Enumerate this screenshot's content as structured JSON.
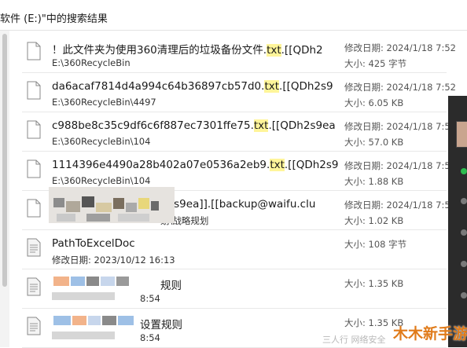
{
  "window": {
    "title": "软件 (E:)\"中的搜索结果"
  },
  "results": [
    {
      "name_pre": "！此文件夹为使用360清理后的垃圾备份文件.",
      "name_hl": "txt",
      "name_post": ".[[QDh2",
      "path": "E:\\360RecycleBin",
      "date": "修改日期: 2024/1/18 7:52",
      "size": "大小: 425 字节"
    },
    {
      "name_pre": "da6acaf7814d4a994c64b36897cb57d0.",
      "name_hl": "txt",
      "name_post": ".[[QDh2s9",
      "path": "E:\\360RecycleBin\\4497",
      "date": "修改日期: 2024/1/18 7:52",
      "size": "大小: 6.05 KB"
    },
    {
      "name_pre": "c988be8c35c9df6c6f887ec7301ffe75.",
      "name_hl": "txt",
      "name_post": ".[[QDh2s9ea",
      "path": "E:\\360RecycleBin\\104",
      "date": "修改日期: 2024/1/18 7:5",
      "size": "大小: 57.0 KB"
    },
    {
      "name_pre": "1114396e4490a28b402a07e0536a2eb9.",
      "name_hl": "txt",
      "name_post": ".[[QDh2s9",
      "path": "E:\\360RecycleBin\\104",
      "date": "修改日期: 2024/1/18 7:5",
      "size": "大小: 1.88 KB"
    },
    {
      "name_pre": "h2s9ea]].[[backup@waifu.clu",
      "name_hl": "",
      "name_post": "",
      "path": "划\\战略规划",
      "date": "修改日期: 2024/1/18 7:5",
      "size": "大小: 1.02 KB"
    },
    {
      "name_pre": "PathToExcelDoc",
      "name_hl": "",
      "name_post": "",
      "path": "修改日期: 2023/10/12 16:13",
      "date": "",
      "size": "大小: 108 字节"
    },
    {
      "name_pre": "规则",
      "name_hl": "",
      "name_post": "",
      "path": "8:54",
      "date": "",
      "size": "大小: 1.35 KB"
    },
    {
      "name_pre": "设置规则",
      "name_hl": "",
      "name_post": "",
      "path": "8:54",
      "date": "",
      "size": "大小: 1.35 KB"
    }
  ],
  "watermark": {
    "text": "木木新手游",
    "faint": "三人行 网络安全"
  },
  "colors": {
    "highlight": "#fff59a",
    "watermark": "#e07b1a",
    "dark_panel": "#2b2b2b"
  }
}
